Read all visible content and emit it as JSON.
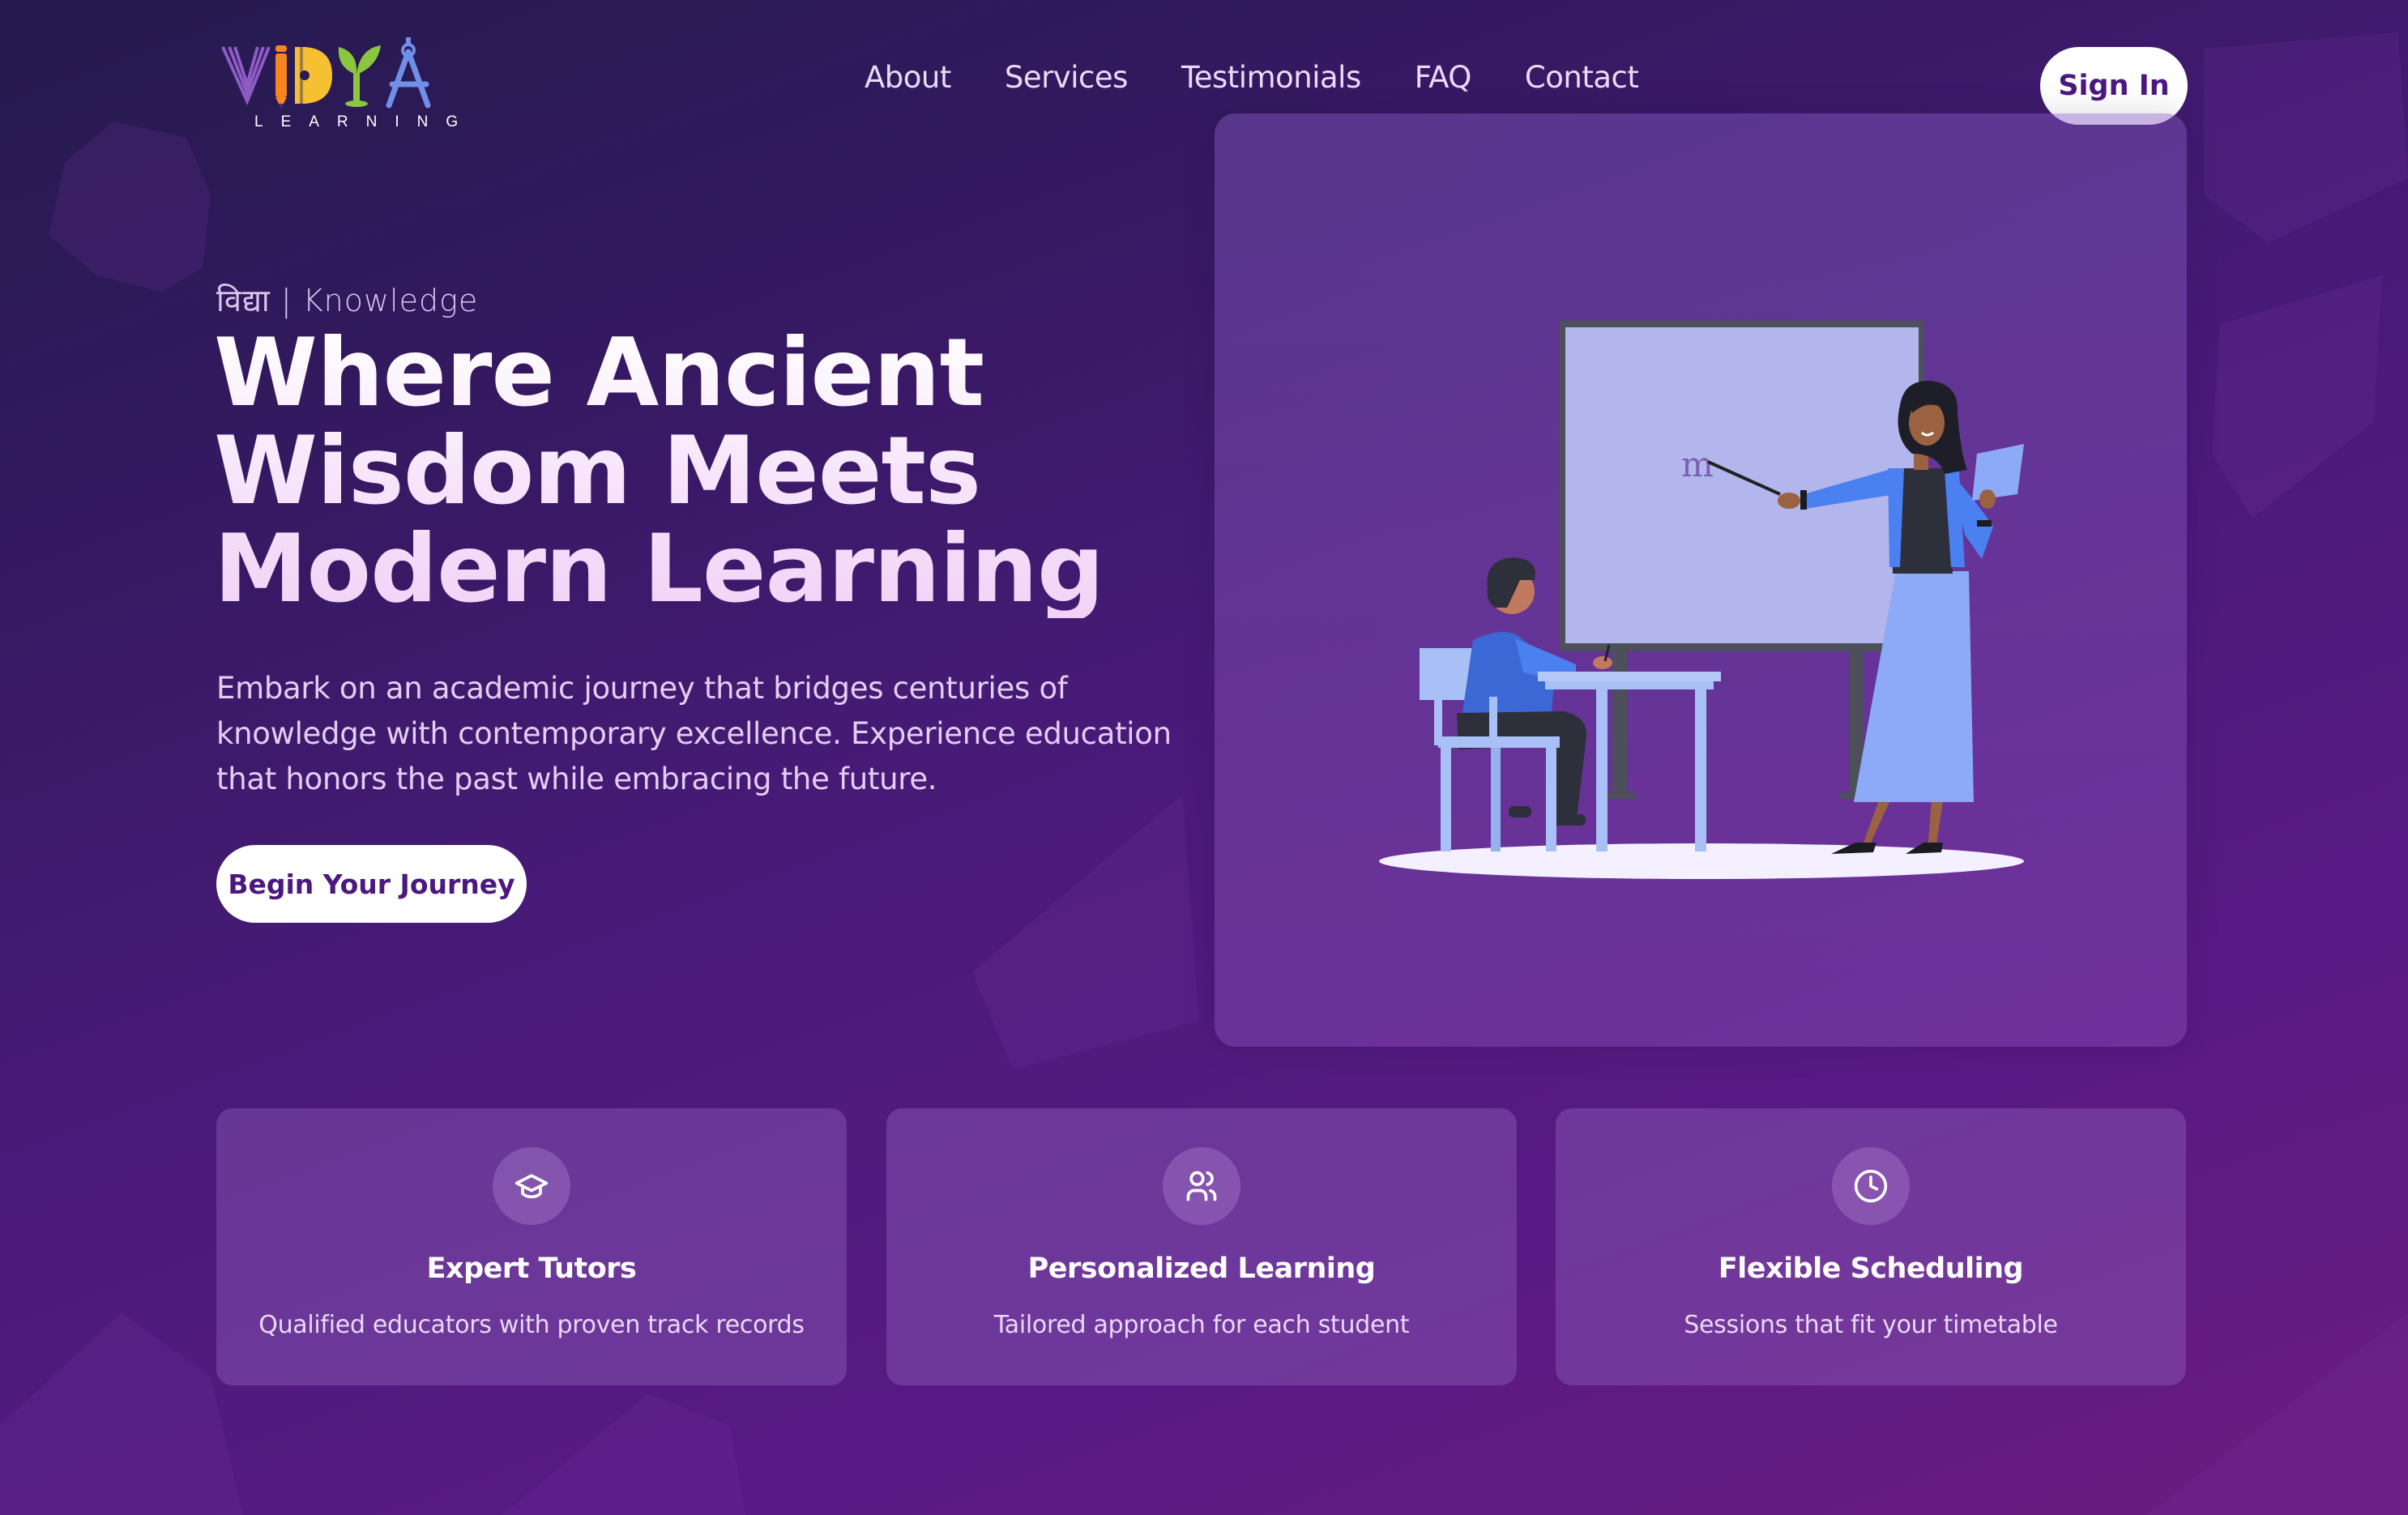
{
  "brand": {
    "logo_letters": [
      "V",
      "I",
      "D",
      "Y",
      "A"
    ],
    "logo_subtitle": "LEARNING",
    "logo_colors": {
      "v": "#8e5bc4",
      "i": "#f5851f",
      "d": "#f5c032",
      "y": "#8cc63f",
      "a": "#6f8fe8"
    }
  },
  "nav": {
    "items": [
      {
        "label": "About"
      },
      {
        "label": "Services"
      },
      {
        "label": "Testimonials"
      },
      {
        "label": "FAQ"
      },
      {
        "label": "Contact"
      }
    ],
    "sign_in_label": "Sign In"
  },
  "hero": {
    "eyebrow": "विद्या | Knowledge",
    "headline_lines": [
      "Where Ancient",
      "Wisdom Meets",
      "Modern Learning"
    ],
    "lead": "Embark on an academic journey that bridges centuries of knowledge with contemporary excellence. Experience education that honors the past while embracing the future.",
    "cta_label": "Begin Your Journey",
    "illustration": {
      "description": "Teacher pointing at whiteboard while student sits at desk",
      "board_letter": "m"
    }
  },
  "features": [
    {
      "icon": "graduation-cap-icon",
      "title": "Expert Tutors",
      "description": "Qualified educators with proven track records"
    },
    {
      "icon": "users-icon",
      "title": "Personalized Learning",
      "description": "Tailored approach for each student"
    },
    {
      "icon": "clock-icon",
      "title": "Flexible Scheduling",
      "description": "Sessions that fit your timetable"
    }
  ],
  "colors": {
    "accent_text": "#4b1880",
    "button_bg": "#ffffff",
    "bg_start": "#251a4e",
    "bg_end": "#6b1c7e"
  }
}
